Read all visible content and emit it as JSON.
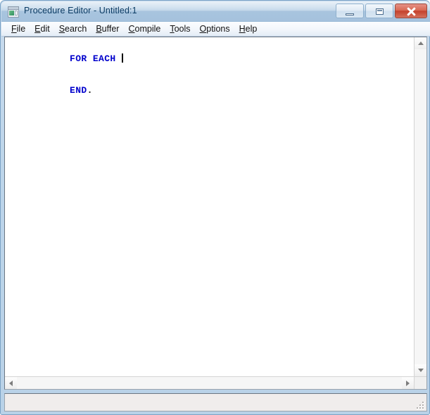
{
  "window": {
    "title": "Procedure Editor - Untitled:1",
    "icon": "procedure-editor-icon",
    "frame_color": "#b9d2e8",
    "titlebar_text_color": "#0b3b63"
  },
  "window_controls": {
    "minimize_label": "Minimize",
    "maximize_label": "Maximize",
    "close_label": "Close",
    "close_color": "#c4412c"
  },
  "menubar": {
    "items": [
      {
        "label": "File",
        "accel": "F"
      },
      {
        "label": "Edit",
        "accel": "E"
      },
      {
        "label": "Search",
        "accel": "S"
      },
      {
        "label": "Buffer",
        "accel": "B"
      },
      {
        "label": "Compile",
        "accel": "C"
      },
      {
        "label": "Tools",
        "accel": "T"
      },
      {
        "label": "Options",
        "accel": "O"
      },
      {
        "label": "Help",
        "accel": "H"
      }
    ]
  },
  "editor": {
    "background": "#ffffff",
    "keyword_color": "#0000cc",
    "text_color": "#000000",
    "lines": [
      {
        "keyword": "FOR EACH",
        "rest": " ",
        "caret": true
      },
      {
        "keyword": "END",
        "rest": ".",
        "caret": false
      }
    ]
  },
  "scrollbars": {
    "vertical": {
      "up_icon": "triangle-up-icon",
      "down_icon": "triangle-down-icon"
    },
    "horizontal": {
      "left_icon": "triangle-left-icon",
      "right_icon": "triangle-right-icon"
    }
  },
  "statusbar": {
    "text": "",
    "grip_icon": "resize-grip-icon"
  }
}
